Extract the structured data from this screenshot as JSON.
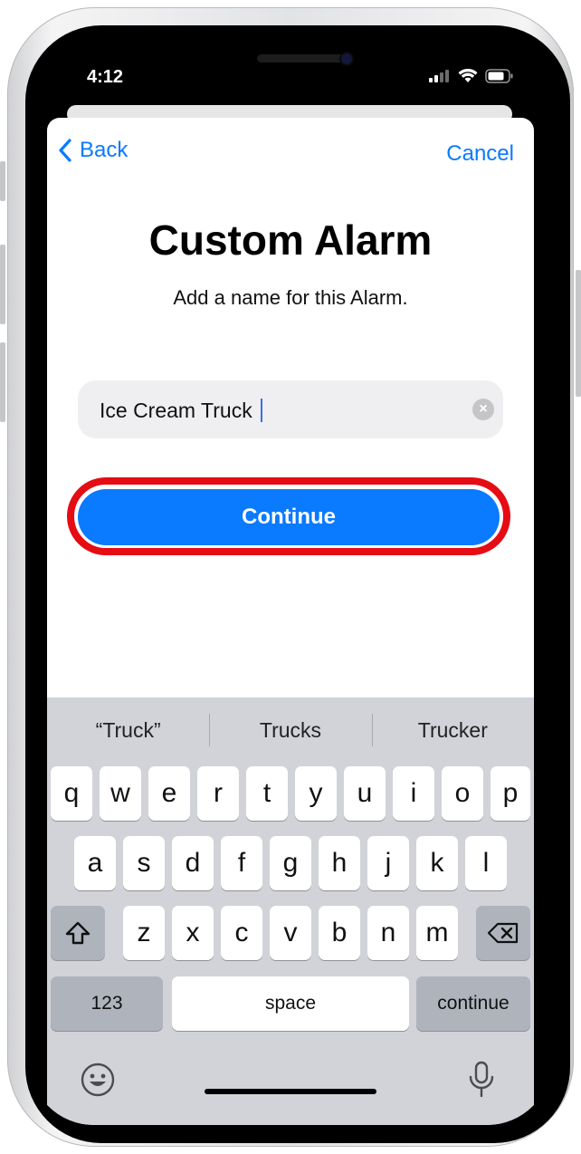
{
  "status_bar": {
    "time": "4:12"
  },
  "nav": {
    "back_label": "Back",
    "cancel_label": "Cancel"
  },
  "page": {
    "title": "Custom Alarm",
    "subtitle": "Add a name for this Alarm."
  },
  "name_field": {
    "value": "Ice Cream Truck",
    "clear_icon": "clear-circle-icon"
  },
  "continue_button": {
    "label": "Continue",
    "color": "#0a7aff",
    "highlight_color": "#e50c14"
  },
  "keyboard": {
    "suggestions": [
      "“Truck”",
      "Trucks",
      "Trucker"
    ],
    "row1": [
      "q",
      "w",
      "e",
      "r",
      "t",
      "y",
      "u",
      "i",
      "o",
      "p"
    ],
    "row2": [
      "a",
      "s",
      "d",
      "f",
      "g",
      "h",
      "j",
      "k",
      "l"
    ],
    "row3": [
      "z",
      "x",
      "c",
      "v",
      "b",
      "n",
      "m"
    ],
    "numbers_label": "123",
    "space_label": "space",
    "return_label": "continue",
    "shift_icon": "shift-icon",
    "delete_icon": "delete-icon",
    "emoji_icon": "emoji-icon",
    "mic_icon": "microphone-icon"
  }
}
